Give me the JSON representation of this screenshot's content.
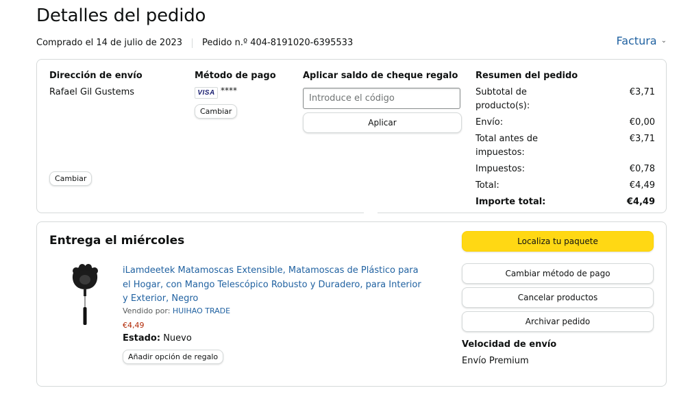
{
  "header": {
    "title": "Detalles del pedido",
    "purchased": "Comprado el 14 de julio de 2023",
    "order_number": "Pedido n.º 404-8191020-6395533",
    "invoice_label": "Factura"
  },
  "shipping": {
    "heading": "Dirección de envío",
    "name": "Rafael Gil Gustems",
    "change_label": "Cambiar"
  },
  "payment": {
    "heading": "Método de pago",
    "card_brand": "VISA",
    "card_mask": "****",
    "change_label": "Cambiar"
  },
  "gift": {
    "heading": "Aplicar saldo de cheque regalo",
    "placeholder": "Introduce el código",
    "apply_label": "Aplicar"
  },
  "summary": {
    "heading": "Resumen del pedido",
    "rows": [
      {
        "label": "Subtotal de producto(s):",
        "value": "€3,71"
      },
      {
        "label": "Envío:",
        "value": "€0,00"
      },
      {
        "label": "Total antes de impuestos:",
        "value": "€3,71"
      },
      {
        "label": "Impuestos:",
        "value": "€0,78"
      },
      {
        "label": "Total:",
        "value": "€4,49"
      }
    ],
    "grand_total_label": "Importe total:",
    "grand_total_value": "€4,49"
  },
  "delivery": {
    "title": "Entrega el miércoles",
    "product": {
      "title": "iLamdeetek Matamoscas Extensible, Matamoscas de Plástico para el Hogar, con Mango Telescópico Robusto y Duradero, para Interior y Exterior, Negro",
      "sold_by_label": "Vendido por: ",
      "seller": "HUIHAO TRADE",
      "price": "€4,49",
      "state_label": "Estado:",
      "state_value": "Nuevo",
      "gift_option_label": "Añadir opción de regalo"
    },
    "actions": {
      "track": "Localiza tu paquete",
      "change_payment": "Cambiar método de pago",
      "cancel": "Cancelar productos",
      "archive": "Archivar pedido"
    },
    "speed_heading": "Velocidad de envío",
    "speed_value": "Envío Premium"
  },
  "colors": {
    "link": "#2162a1",
    "primary_button": "#ffd814",
    "price": "#b12704",
    "border": "#d5d9d9"
  }
}
